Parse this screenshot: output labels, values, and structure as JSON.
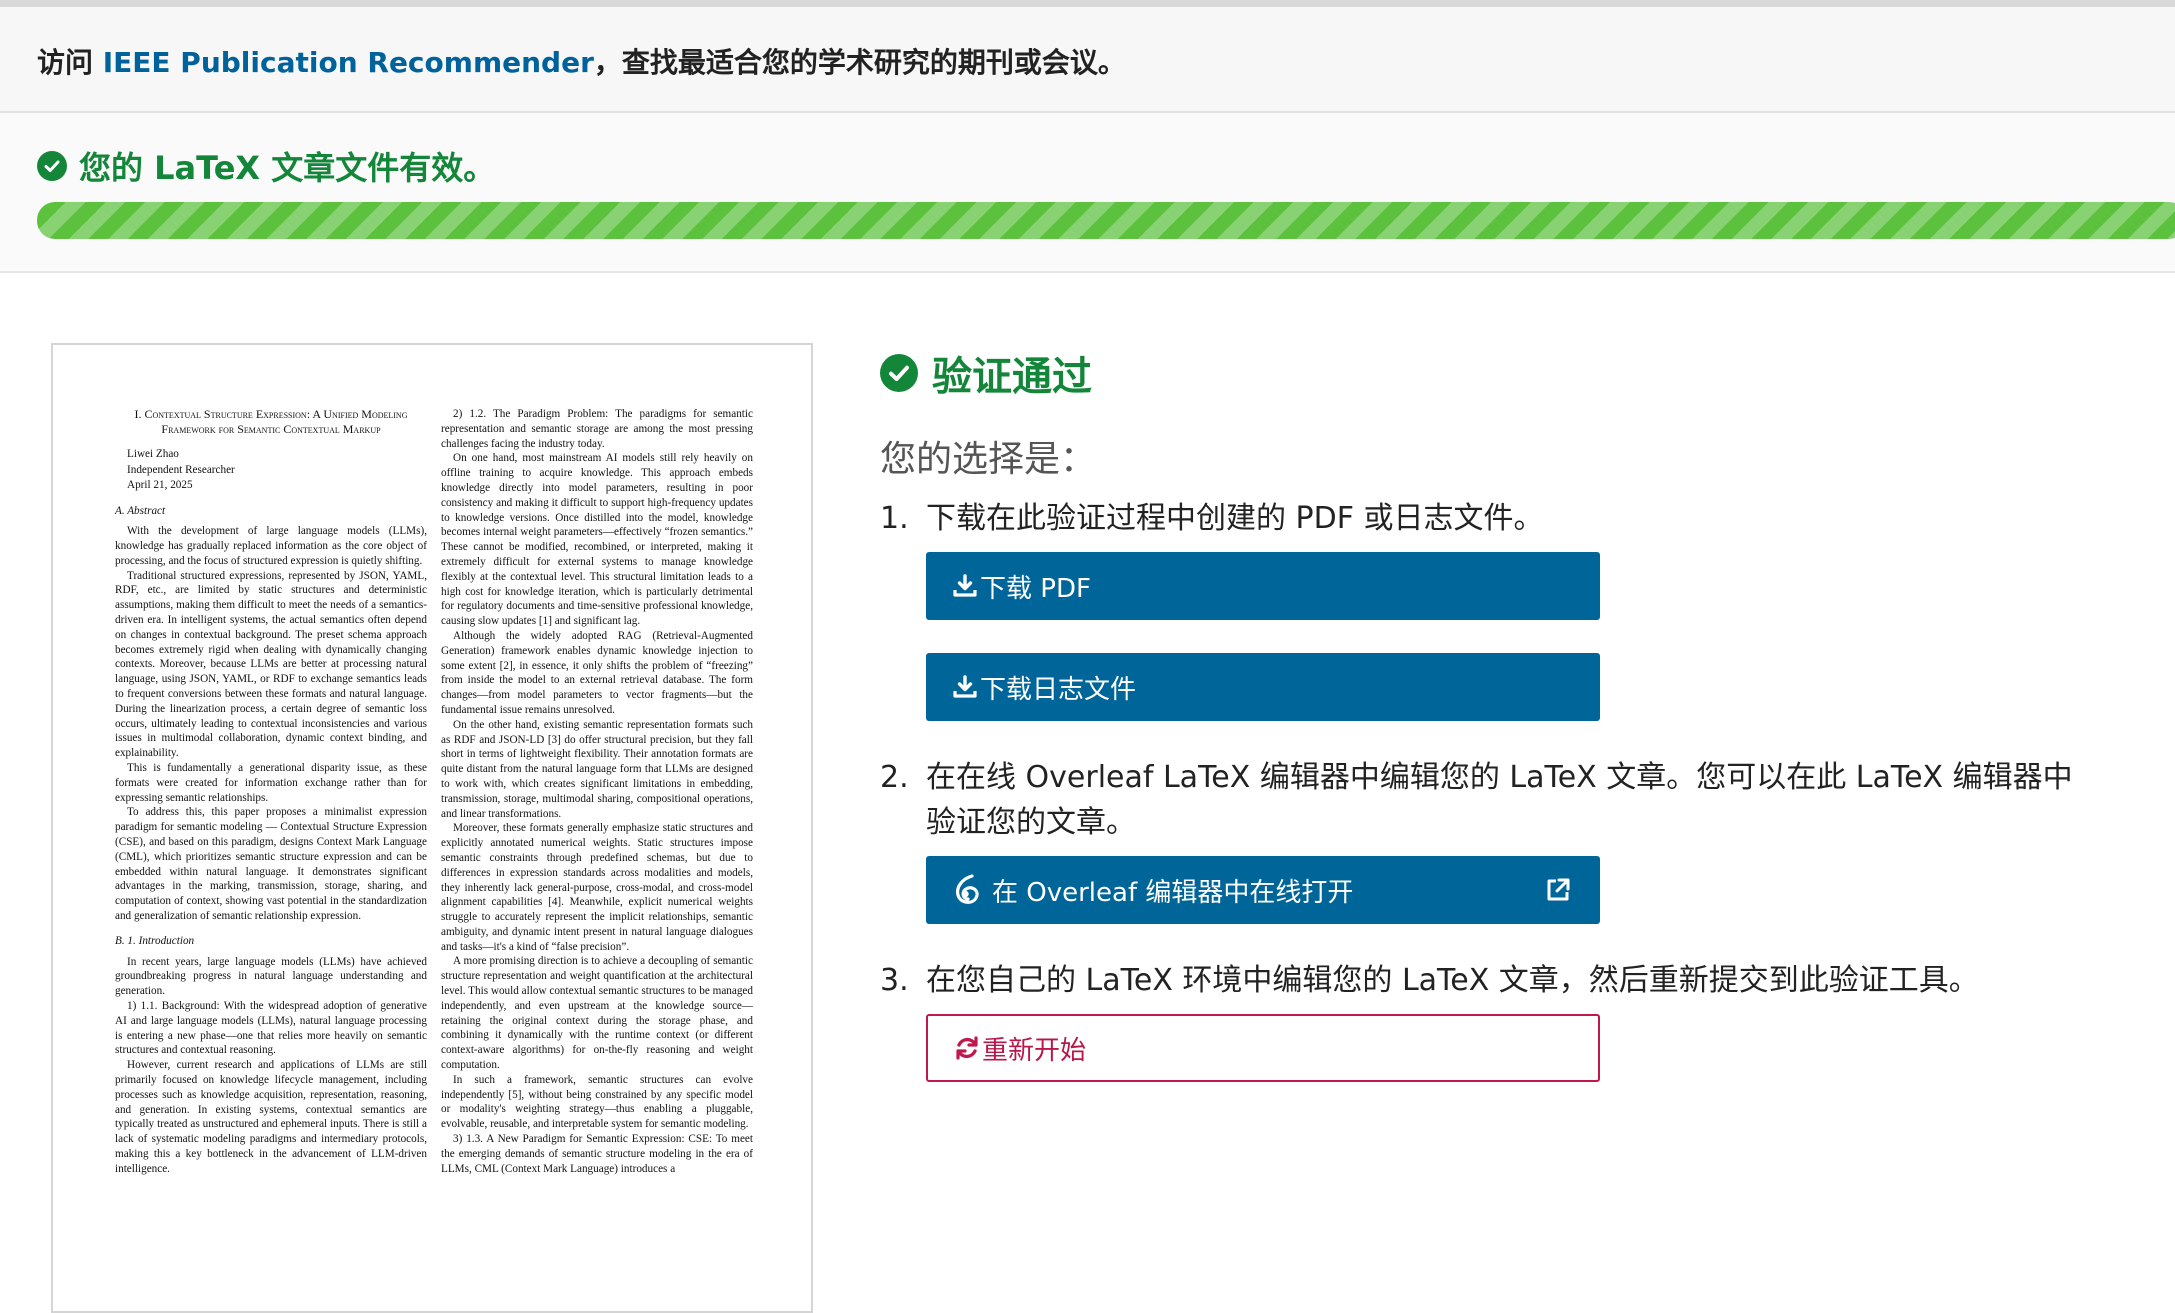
{
  "banner": {
    "prefix": "访问 ",
    "link": "IEEE Publication Recommender",
    "suffix": "，查找最适合您的学术研究的期刊或会议。"
  },
  "status": {
    "message": "您的 LaTeX 文章文件有效。",
    "progress_percent": 100
  },
  "preview": {
    "title": "I. Contextual Structure Expression: A Unified Modeling Framework for Semantic Contextual Markup",
    "author": "Liwei Zhao",
    "affiliation": "Independent Researcher",
    "date": "April 21, 2025",
    "left": {
      "abstract_heading": "A. Abstract",
      "abstract_p1": "With the development of large language models (LLMs), knowledge has gradually replaced information as the core object of processing, and the focus of structured expression is quietly shifting.",
      "abstract_p2": "Traditional structured expressions, represented by JSON, YAML, RDF, etc., are limited by static structures and deterministic assumptions, making them difficult to meet the needs of a semantics-driven era. In intelligent systems, the actual semantics often depend on changes in contextual background. The preset schema approach becomes extremely rigid when dealing with dynamically changing contexts. Moreover, because LLMs are better at processing natural language, using JSON, YAML, or RDF to exchange semantics leads to frequent conversions between these formats and natural language. During the linearization process, a certain degree of semantic loss occurs, ultimately leading to contextual inconsistencies and various issues in multimodal collaboration, dynamic context binding, and explainability.",
      "abstract_p3": "This is fundamentally a generational disparity issue, as these formats were created for information exchange rather than for expressing semantic relationships.",
      "abstract_p4": "To address this, this paper proposes a minimalist expression paradigm for semantic modeling — Contextual Structure Expression (CSE), and based on this paradigm, designs Context Mark Language (CML), which prioritizes semantic structure expression and can be embedded within natural language. It demonstrates significant advantages in the marking, transmission, storage, sharing, and computation of context, showing vast potential in the standardization and generalization of semantic relationship expression.",
      "intro_heading": "B. 1. Introduction",
      "intro_p1": "In recent years, large language models (LLMs) have achieved groundbreaking progress in natural language understanding and generation.",
      "intro_p2": "1) 1.1. Background: With the widespread adoption of generative AI and large language models (LLMs), natural language processing is entering a new phase—one that relies more heavily on semantic structures and contextual reasoning.",
      "intro_p3": "However, current research and applications of LLMs are still primarily focused on knowledge lifecycle management, including processes such as knowledge acquisition, representation, reasoning, and generation. In existing systems, contextual semantics are typically treated as unstructured and ephemeral inputs. There is still a lack of systematic modeling paradigms and intermediary protocols, making this a key bottleneck in the advancement of LLM-driven intelligence."
    },
    "right": {
      "p1": "2) 1.2. The Paradigm Problem: The paradigms for semantic representation and semantic storage are among the most pressing challenges facing the industry today.",
      "p2": "On one hand, most mainstream AI models still rely heavily on offline training to acquire knowledge. This approach embeds knowledge directly into model parameters, resulting in poor consistency and making it difficult to support high-frequency updates to knowledge versions. Once distilled into the model, knowledge becomes internal weight parameters—effectively “frozen semantics.” These cannot be modified, recombined, or interpreted, making it extremely difficult for external systems to manage knowledge flexibly at the contextual level. This structural limitation leads to a high cost for knowledge iteration, which is particularly detrimental for regulatory documents and time-sensitive professional knowledge, causing slow updates [1] and significant lag.",
      "p3": "Although the widely adopted RAG (Retrieval-Augmented Generation) framework enables dynamic knowledge injection to some extent [2], in essence, it only shifts the problem of “freezing” from inside the model to an external retrieval database. The form changes—from model parameters to vector fragments—but the fundamental issue remains unresolved.",
      "p4": "On the other hand, existing semantic representation formats such as RDF and JSON-LD [3] do offer structural precision, but they fall short in terms of lightweight flexibility. Their annotation formats are quite distant from the natural language form that LLMs are designed to work with, which creates significant limitations in embedding, transmission, storage, multimodal sharing, compositional operations, and linear transformations.",
      "p5": "Moreover, these formats generally emphasize static structures and explicitly annotated numerical weights. Static structures impose semantic constraints through predefined schemas, but due to differences in expression standards across modalities and models, they inherently lack general-purpose, cross-modal, and cross-model alignment capabilities [4]. Meanwhile, explicit numerical weights struggle to accurately represent the implicit relationships, semantic ambiguity, and dynamic intent present in natural language dialogues and tasks—it's a kind of “false precision”.",
      "p6": "A more promising direction is to achieve a decoupling of semantic structure representation and weight quantification at the architectural level. This would allow contextual semantic structures to be managed independently, and even upstream at the knowledge source—retaining the original context during the storage phase, and combining it dynamically with the runtime context (or different context-aware algorithms) for on-the-fly reasoning and weight computation.",
      "p7": "In such a framework, semantic structures can evolve independently [5], without being constrained by any specific model or modality's weighting strategy—thus enabling a pluggable, evolvable, reusable, and interpretable system for semantic modeling.",
      "p8": "3) 1.3. A New Paradigm for Semantic Expression: CSE: To meet the emerging demands of semantic structure modeling in the era of LLMs, CML (Context Mark Language) introduces a"
    }
  },
  "panel": {
    "verify_title": "验证通过",
    "choice_title": "您的选择是：",
    "step1_num": "1.",
    "step1_text": "下载在此验证过程中创建的 PDF 或日志文件。",
    "btn_pdf": "下载 PDF",
    "btn_log": "下载日志文件",
    "step2_num": "2.",
    "step2_text": "在在线 Overleaf LaTeX 编辑器中编辑您的 LaTeX 文章。您可以在此 LaTeX 编辑器中验证您的文章。",
    "btn_overleaf": "在 Overleaf 编辑器中在线打开",
    "step3_num": "3.",
    "step3_text": "在您自己的 LaTeX 环境中编辑您的 LaTeX 文章，然后重新提交到此验证工具。",
    "btn_restart": "重新开始"
  },
  "colors": {
    "ieee_blue": "#00629b",
    "button_blue": "#006699",
    "success_green": "#14863a",
    "progress_green": "#5cc13d",
    "restart_red": "#c0184c"
  },
  "icons": [
    "check-circle-icon",
    "download-icon",
    "overleaf-icon",
    "external-link-icon",
    "refresh-icon"
  ]
}
